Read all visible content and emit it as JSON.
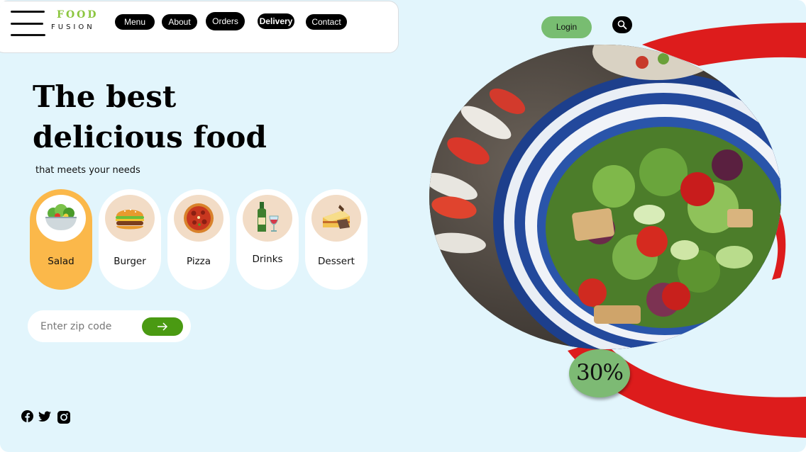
{
  "brand": {
    "line1": "FOOD",
    "line2": "FUSION",
    "accent": "#8cc63f"
  },
  "nav": [
    "Menu",
    "About",
    "Orders",
    "Delivery",
    "Contact"
  ],
  "header_actions": {
    "login_label": "Login",
    "search_icon": "search-icon"
  },
  "hero": {
    "title": "The best delicious food",
    "subtitle": "that meets your needs"
  },
  "categories": [
    {
      "label": "Salad",
      "icon": "salad-bowl-icon",
      "active": true
    },
    {
      "label": "Burger",
      "icon": "burger-icon",
      "active": false
    },
    {
      "label": "Pizza",
      "icon": "pizza-icon",
      "active": false
    },
    {
      "label": "Drinks",
      "icon": "drinks-icon",
      "active": false
    },
    {
      "label": "Dessert",
      "icon": "cake-slice-icon",
      "active": false
    }
  ],
  "zip": {
    "placeholder": "Enter zip code",
    "submit_icon": "arrow-right-icon"
  },
  "promo": {
    "badge": "30%"
  },
  "social": [
    "facebook-icon",
    "twitter-icon",
    "instagram-icon"
  ],
  "colors": {
    "background": "#e2f5fc",
    "active_card": "#fbb84a",
    "login": "#78bd71",
    "zip_button": "#4a9a12",
    "ring": "#dd1c1c",
    "badge": "#7dba74"
  }
}
